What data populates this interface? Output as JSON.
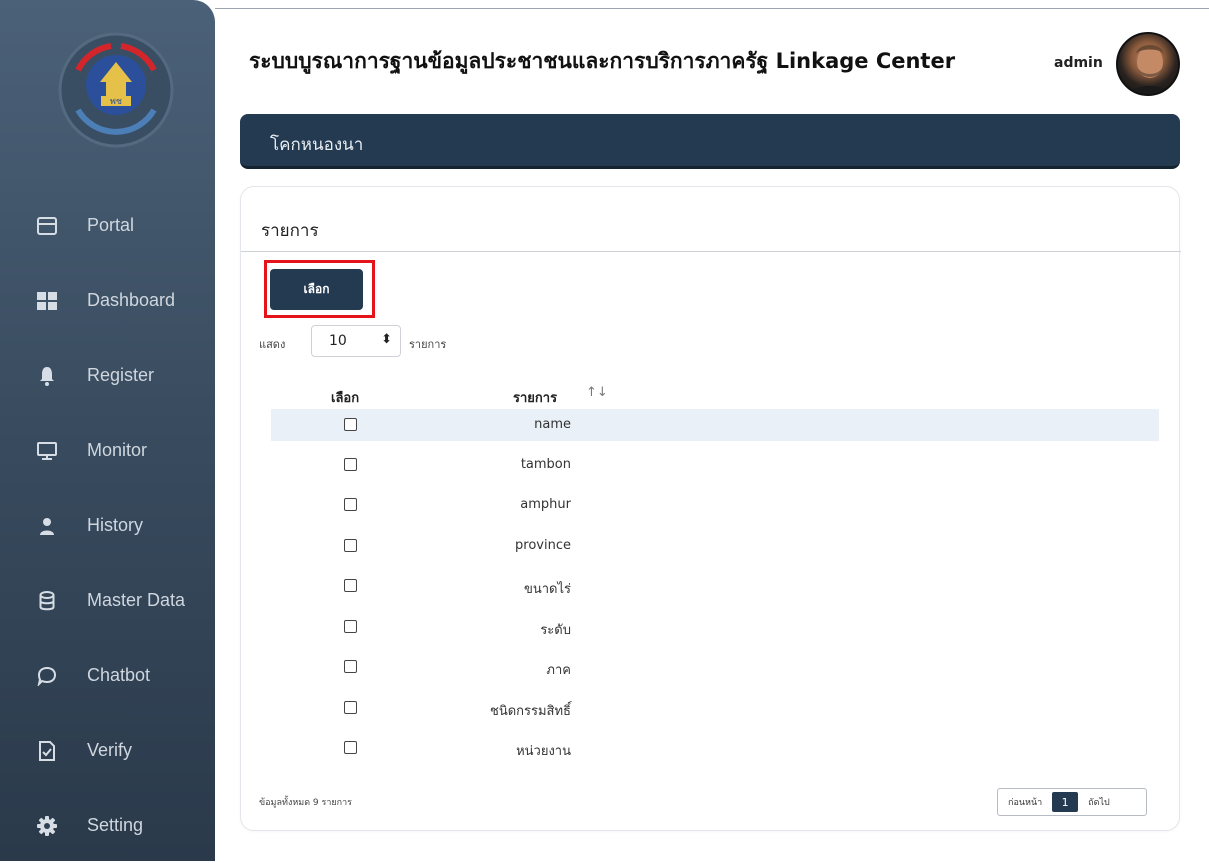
{
  "sidebar": {
    "items": [
      {
        "label": "Portal",
        "icon": "card-icon"
      },
      {
        "label": "Dashboard",
        "icon": "grid-icon"
      },
      {
        "label": "Register",
        "icon": "bell-icon"
      },
      {
        "label": "Monitor",
        "icon": "monitor-icon"
      },
      {
        "label": "History",
        "icon": "user-icon"
      },
      {
        "label": "Master Data",
        "icon": "database-icon"
      },
      {
        "label": "Chatbot",
        "icon": "chat-icon"
      },
      {
        "label": "Verify",
        "icon": "file-check-icon"
      },
      {
        "label": "Setting",
        "icon": "gear-icon"
      }
    ]
  },
  "header": {
    "title": "ระบบบูรณาการฐานข้อมูลประชาชนและการบริการภาครัฐ  Linkage Center",
    "user": "admin"
  },
  "banner": {
    "title": "โคกหนองนา"
  },
  "card": {
    "title": "รายการ",
    "select_button": "เลือก",
    "show_label": "แสดง",
    "page_size": "10",
    "show_suffix": "รายการ",
    "columns": {
      "select": "เลือก",
      "item": "รายการ"
    },
    "rows": [
      "name",
      "tambon",
      "amphur",
      "province",
      "ขนาดไร่",
      "ระดับ",
      "ภาค",
      "ชนิดกรรมสิทธิ์",
      "หน่วยงาน"
    ],
    "footer_info": "ข้อมูลทั้งหมด 9 รายการ",
    "pager": {
      "prev": "ก่อนหน้า",
      "page": "1",
      "next": "ถัดไป"
    }
  },
  "colors": {
    "sidebar": "#3e5267",
    "accent": "#243a51",
    "highlight_border": "#e5141b",
    "row_highlight": "#e9f0f7"
  }
}
